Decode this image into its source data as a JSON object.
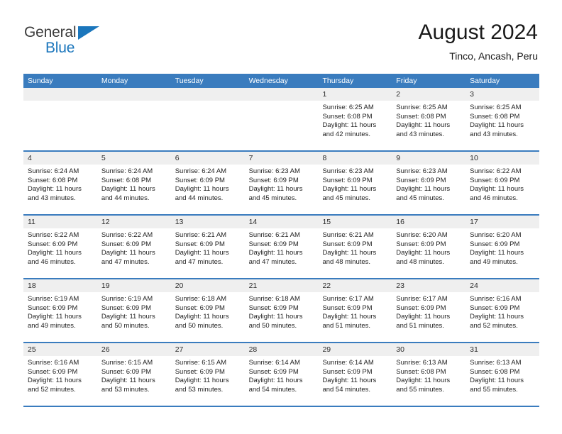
{
  "brand": {
    "name_part1": "General",
    "name_part2": "Blue",
    "triangle_color": "#1b76bc"
  },
  "header": {
    "title": "August 2024",
    "subtitle": "Tinco, Ancash, Peru"
  },
  "theme": {
    "header_bar_color": "#3a7cbe",
    "daynum_band_color": "#efefef",
    "text_color": "#222222"
  },
  "calendar": {
    "weekdays": [
      "Sunday",
      "Monday",
      "Tuesday",
      "Wednesday",
      "Thursday",
      "Friday",
      "Saturday"
    ],
    "labels": {
      "sunrise_prefix": "Sunrise: ",
      "sunset_prefix": "Sunset: ",
      "daylight_prefix": "Daylight: "
    },
    "weeks": [
      [
        {
          "day": "",
          "sunrise": "",
          "sunset": "",
          "daylight_line1": "",
          "daylight_line2": ""
        },
        {
          "day": "",
          "sunrise": "",
          "sunset": "",
          "daylight_line1": "",
          "daylight_line2": ""
        },
        {
          "day": "",
          "sunrise": "",
          "sunset": "",
          "daylight_line1": "",
          "daylight_line2": ""
        },
        {
          "day": "",
          "sunrise": "",
          "sunset": "",
          "daylight_line1": "",
          "daylight_line2": ""
        },
        {
          "day": "1",
          "sunrise": "Sunrise: 6:25 AM",
          "sunset": "Sunset: 6:08 PM",
          "daylight_line1": "Daylight: 11 hours",
          "daylight_line2": "and 42 minutes."
        },
        {
          "day": "2",
          "sunrise": "Sunrise: 6:25 AM",
          "sunset": "Sunset: 6:08 PM",
          "daylight_line1": "Daylight: 11 hours",
          "daylight_line2": "and 43 minutes."
        },
        {
          "day": "3",
          "sunrise": "Sunrise: 6:25 AM",
          "sunset": "Sunset: 6:08 PM",
          "daylight_line1": "Daylight: 11 hours",
          "daylight_line2": "and 43 minutes."
        }
      ],
      [
        {
          "day": "4",
          "sunrise": "Sunrise: 6:24 AM",
          "sunset": "Sunset: 6:08 PM",
          "daylight_line1": "Daylight: 11 hours",
          "daylight_line2": "and 43 minutes."
        },
        {
          "day": "5",
          "sunrise": "Sunrise: 6:24 AM",
          "sunset": "Sunset: 6:08 PM",
          "daylight_line1": "Daylight: 11 hours",
          "daylight_line2": "and 44 minutes."
        },
        {
          "day": "6",
          "sunrise": "Sunrise: 6:24 AM",
          "sunset": "Sunset: 6:09 PM",
          "daylight_line1": "Daylight: 11 hours",
          "daylight_line2": "and 44 minutes."
        },
        {
          "day": "7",
          "sunrise": "Sunrise: 6:23 AM",
          "sunset": "Sunset: 6:09 PM",
          "daylight_line1": "Daylight: 11 hours",
          "daylight_line2": "and 45 minutes."
        },
        {
          "day": "8",
          "sunrise": "Sunrise: 6:23 AM",
          "sunset": "Sunset: 6:09 PM",
          "daylight_line1": "Daylight: 11 hours",
          "daylight_line2": "and 45 minutes."
        },
        {
          "day": "9",
          "sunrise": "Sunrise: 6:23 AM",
          "sunset": "Sunset: 6:09 PM",
          "daylight_line1": "Daylight: 11 hours",
          "daylight_line2": "and 45 minutes."
        },
        {
          "day": "10",
          "sunrise": "Sunrise: 6:22 AM",
          "sunset": "Sunset: 6:09 PM",
          "daylight_line1": "Daylight: 11 hours",
          "daylight_line2": "and 46 minutes."
        }
      ],
      [
        {
          "day": "11",
          "sunrise": "Sunrise: 6:22 AM",
          "sunset": "Sunset: 6:09 PM",
          "daylight_line1": "Daylight: 11 hours",
          "daylight_line2": "and 46 minutes."
        },
        {
          "day": "12",
          "sunrise": "Sunrise: 6:22 AM",
          "sunset": "Sunset: 6:09 PM",
          "daylight_line1": "Daylight: 11 hours",
          "daylight_line2": "and 47 minutes."
        },
        {
          "day": "13",
          "sunrise": "Sunrise: 6:21 AM",
          "sunset": "Sunset: 6:09 PM",
          "daylight_line1": "Daylight: 11 hours",
          "daylight_line2": "and 47 minutes."
        },
        {
          "day": "14",
          "sunrise": "Sunrise: 6:21 AM",
          "sunset": "Sunset: 6:09 PM",
          "daylight_line1": "Daylight: 11 hours",
          "daylight_line2": "and 47 minutes."
        },
        {
          "day": "15",
          "sunrise": "Sunrise: 6:21 AM",
          "sunset": "Sunset: 6:09 PM",
          "daylight_line1": "Daylight: 11 hours",
          "daylight_line2": "and 48 minutes."
        },
        {
          "day": "16",
          "sunrise": "Sunrise: 6:20 AM",
          "sunset": "Sunset: 6:09 PM",
          "daylight_line1": "Daylight: 11 hours",
          "daylight_line2": "and 48 minutes."
        },
        {
          "day": "17",
          "sunrise": "Sunrise: 6:20 AM",
          "sunset": "Sunset: 6:09 PM",
          "daylight_line1": "Daylight: 11 hours",
          "daylight_line2": "and 49 minutes."
        }
      ],
      [
        {
          "day": "18",
          "sunrise": "Sunrise: 6:19 AM",
          "sunset": "Sunset: 6:09 PM",
          "daylight_line1": "Daylight: 11 hours",
          "daylight_line2": "and 49 minutes."
        },
        {
          "day": "19",
          "sunrise": "Sunrise: 6:19 AM",
          "sunset": "Sunset: 6:09 PM",
          "daylight_line1": "Daylight: 11 hours",
          "daylight_line2": "and 50 minutes."
        },
        {
          "day": "20",
          "sunrise": "Sunrise: 6:18 AM",
          "sunset": "Sunset: 6:09 PM",
          "daylight_line1": "Daylight: 11 hours",
          "daylight_line2": "and 50 minutes."
        },
        {
          "day": "21",
          "sunrise": "Sunrise: 6:18 AM",
          "sunset": "Sunset: 6:09 PM",
          "daylight_line1": "Daylight: 11 hours",
          "daylight_line2": "and 50 minutes."
        },
        {
          "day": "22",
          "sunrise": "Sunrise: 6:17 AM",
          "sunset": "Sunset: 6:09 PM",
          "daylight_line1": "Daylight: 11 hours",
          "daylight_line2": "and 51 minutes."
        },
        {
          "day": "23",
          "sunrise": "Sunrise: 6:17 AM",
          "sunset": "Sunset: 6:09 PM",
          "daylight_line1": "Daylight: 11 hours",
          "daylight_line2": "and 51 minutes."
        },
        {
          "day": "24",
          "sunrise": "Sunrise: 6:16 AM",
          "sunset": "Sunset: 6:09 PM",
          "daylight_line1": "Daylight: 11 hours",
          "daylight_line2": "and 52 minutes."
        }
      ],
      [
        {
          "day": "25",
          "sunrise": "Sunrise: 6:16 AM",
          "sunset": "Sunset: 6:09 PM",
          "daylight_line1": "Daylight: 11 hours",
          "daylight_line2": "and 52 minutes."
        },
        {
          "day": "26",
          "sunrise": "Sunrise: 6:15 AM",
          "sunset": "Sunset: 6:09 PM",
          "daylight_line1": "Daylight: 11 hours",
          "daylight_line2": "and 53 minutes."
        },
        {
          "day": "27",
          "sunrise": "Sunrise: 6:15 AM",
          "sunset": "Sunset: 6:09 PM",
          "daylight_line1": "Daylight: 11 hours",
          "daylight_line2": "and 53 minutes."
        },
        {
          "day": "28",
          "sunrise": "Sunrise: 6:14 AM",
          "sunset": "Sunset: 6:09 PM",
          "daylight_line1": "Daylight: 11 hours",
          "daylight_line2": "and 54 minutes."
        },
        {
          "day": "29",
          "sunrise": "Sunrise: 6:14 AM",
          "sunset": "Sunset: 6:09 PM",
          "daylight_line1": "Daylight: 11 hours",
          "daylight_line2": "and 54 minutes."
        },
        {
          "day": "30",
          "sunrise": "Sunrise: 6:13 AM",
          "sunset": "Sunset: 6:08 PM",
          "daylight_line1": "Daylight: 11 hours",
          "daylight_line2": "and 55 minutes."
        },
        {
          "day": "31",
          "sunrise": "Sunrise: 6:13 AM",
          "sunset": "Sunset: 6:08 PM",
          "daylight_line1": "Daylight: 11 hours",
          "daylight_line2": "and 55 minutes."
        }
      ]
    ]
  }
}
